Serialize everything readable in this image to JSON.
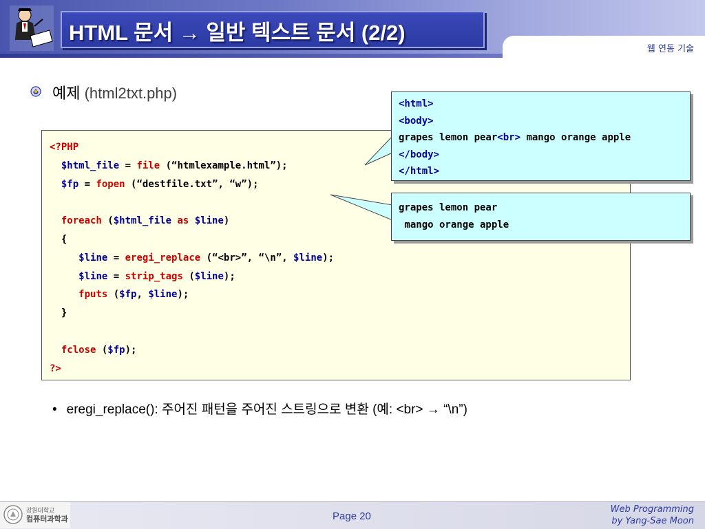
{
  "header": {
    "title": "HTML 문서 → 일반 텍스트 문서 (2/2)",
    "tab_label": "웹 연동 기술"
  },
  "heading": {
    "label": "예제",
    "file": "(html2txt.php)"
  },
  "code": {
    "lines": [
      "<?PHP",
      "$html_file = file (“htmlexample.html”);",
      "$fp = fopen (“destfile.txt”, “w”);",
      "",
      "foreach ($html_file as $line)",
      "{",
      "$line = eregi_replace (“<br>”, “\\n”, $line);",
      "$line = strip_tags ($line);",
      "fputs ($fp, $line);",
      "}",
      "",
      "fclose ($fp);",
      "?>"
    ]
  },
  "callout_html": {
    "lines": [
      "<html>",
      "<body>",
      "grapes lemon pear<br> mango orange apple",
      "</body>",
      "</html>"
    ]
  },
  "callout_text": {
    "lines": [
      "grapes lemon pear",
      " mango orange apple"
    ]
  },
  "note": {
    "bullet": "•",
    "text": "eregi_replace(): 주어진 패턴을 주어진 스트링으로 변환 (예: <br> → “\\n”)"
  },
  "footer": {
    "dept_line1": "강원대학교",
    "dept_line2": "컴퓨터과학과",
    "page": "Page 20",
    "credit_line1": "Web Programming",
    "credit_line2": "by Yang-Sae Moon"
  },
  "colors": {
    "header_blue": "#2c3aa3",
    "code_background": "#ffffe6",
    "callout_background": "#ccffff",
    "keyword_red": "#cc0000",
    "variable_blue": "#000099"
  },
  "icons": [
    "teacher-logo-icon",
    "bullet-globe-icon",
    "university-seal-icon"
  ]
}
